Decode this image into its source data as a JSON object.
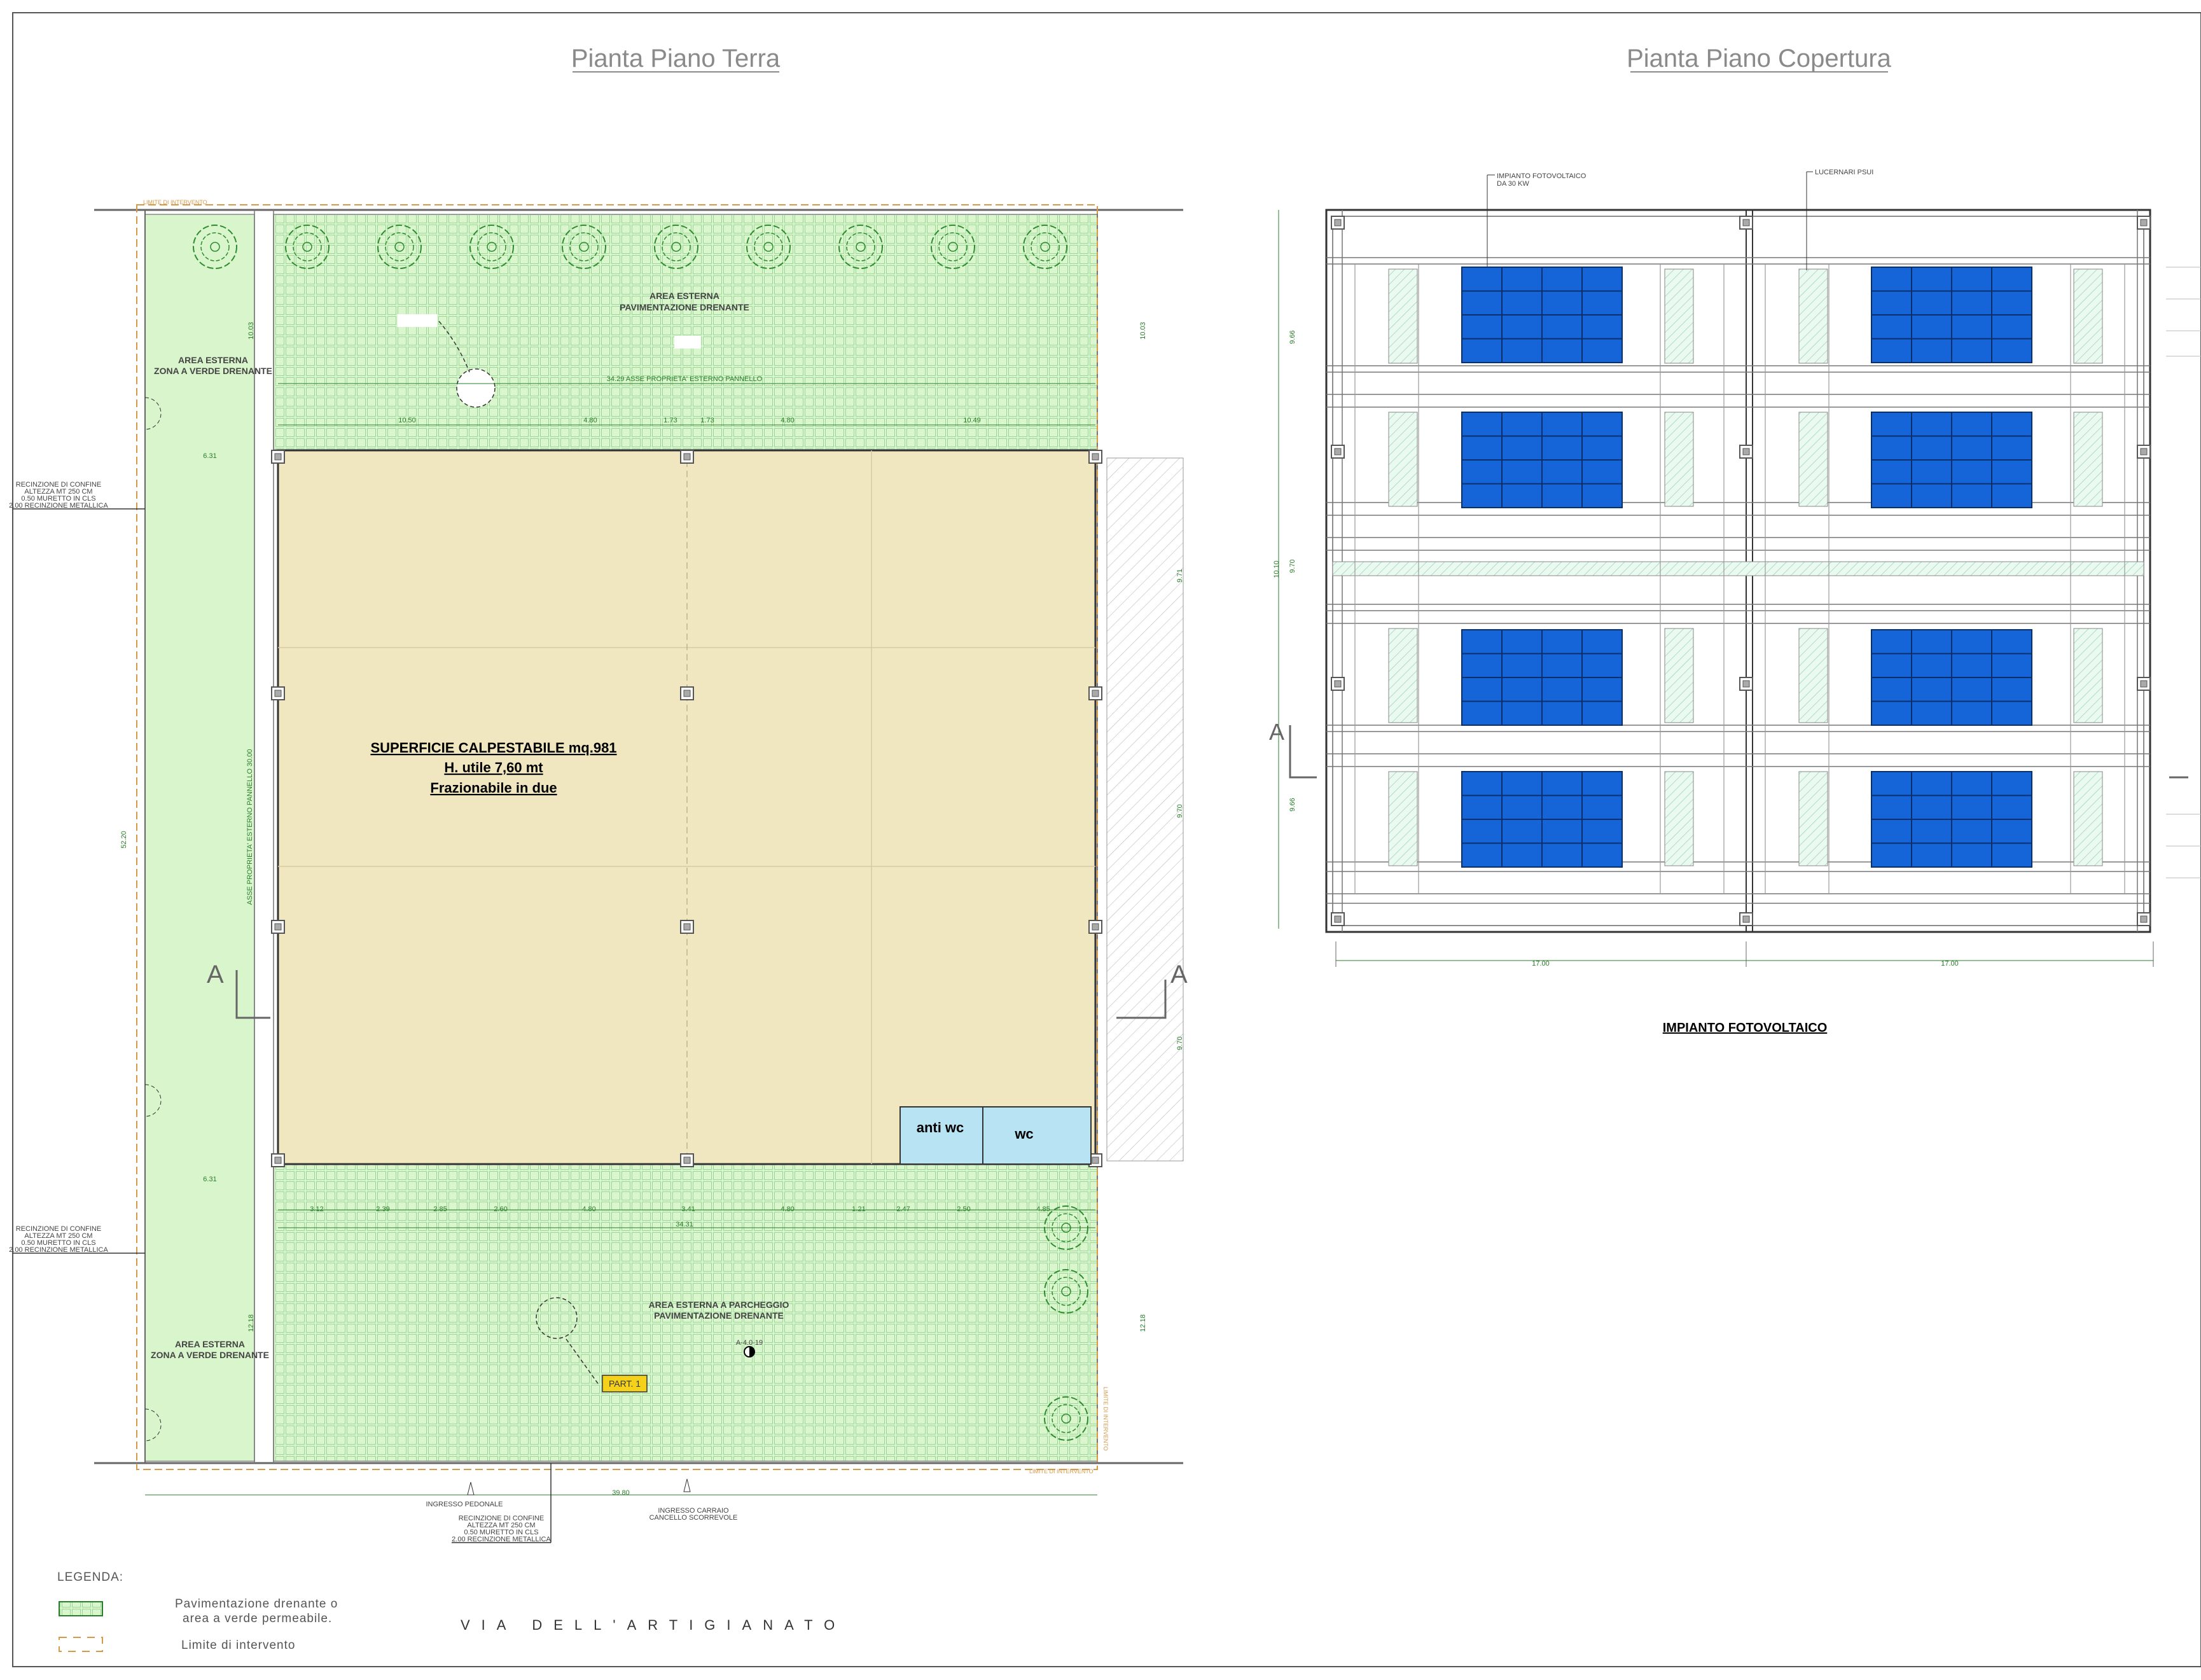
{
  "sheet": {
    "ground_plan_title": "Pianta Piano Terra",
    "roof_plan_title": "Pianta Piano Copertura"
  },
  "ground_plan": {
    "limite_top": "LIMITE DI INTERVENTO",
    "limite_bottom": "LIMITE DI INTERVENTO",
    "limite_right": "LIMITE DI INTERVENTO",
    "area_top": [
      "AREA ESTERNA",
      "PAVIMENTAZIONE DRENANTE"
    ],
    "area_left_top": [
      "AREA ESTERNA",
      "ZONA A VERDE DRENANTE"
    ],
    "area_left_bottom": [
      "AREA ESTERNA",
      "ZONA A VERDE DRENANTE"
    ],
    "area_bottom": [
      "AREA ESTERNA A PARCHEGGIO",
      "PAVIMENTAZIONE DRENANTE"
    ],
    "asse_top": "34.29 ASSE PROPRIETA' ESTERNO PANNELLO",
    "asse_left": "ASSE PROPRIETA' ESTERNO PANNELLO 30.00",
    "main_label": [
      "SUPERFICIE CALPESTABILE mq.981",
      "H. utile 7,60 mt",
      "Frazionabile in due"
    ],
    "anti_wc": "anti wc",
    "wc": "wc",
    "part_tag": "PART. 1",
    "fence_note_1": [
      "RECINZIONE DI CONFINE",
      "ALTEZZA MT 250 CM",
      "0.50 MURETTO IN CLS",
      "2.00 RECINZIONE METALLICA"
    ],
    "fence_note_2": [
      "RECINZIONE DI CONFINE",
      "ALTEZZA MT 250 CM",
      "0.50 MURETTO IN CLS",
      "2.00 RECINZIONE METALLICA"
    ],
    "fence_note_3": [
      "RECINZIONE DI CONFINE",
      "ALTEZZA MT 250 CM",
      "0.50 MURETTO IN CLS",
      "2.00 RECINZIONE METALLICA"
    ],
    "ingresso_pedonale": "INGRESSO PEDONALE",
    "ingresso_carraio": [
      "INGRESSO CARRAIO",
      "CANCELLO SCORREVOLE"
    ],
    "section_mark": "A",
    "dims_top": [
      "10.50",
      "4.80",
      "1.73",
      "1.73",
      "4.80",
      "10.49"
    ],
    "dims_bottom": [
      "3.12",
      "2.39",
      "2.85",
      "2.60",
      "4.80",
      "3.41",
      "4.80",
      "1.21",
      "2.47",
      "2.50",
      "4.85"
    ],
    "dim_total_bottom": "34.31",
    "dim_total_street": "39.80",
    "dim_side_left": "52.20",
    "dim_top_depth": "10.03",
    "dim_bottom_depth": "12.18",
    "dim_right_1": "9.71",
    "dim_right_2": "9.70",
    "dim_right_3": "9.70",
    "dim_left_offset": "6.31",
    "dim_left_offset_2": "6.31",
    "tiny_note": "A-4.0-19"
  },
  "roof_plan": {
    "pv_callout": [
      "IMPIANTO FOTOVOLTAICO",
      "DA 30 KW"
    ],
    "skylight_callout": "LUCERNARI PSUI",
    "dim_bottom": [
      "17.00",
      "17.00"
    ],
    "dim_left": [
      "9.66",
      "10.10",
      "9.70",
      "9.66"
    ],
    "section_mark": "A",
    "caption": "IMPIANTO FOTOVOLTAICO"
  },
  "legend": {
    "title": "LEGENDA:",
    "item1": [
      "Pavimentazione drenante o",
      "area a verde permeabile."
    ],
    "item2": "Limite di intervento"
  },
  "street": "VIA DELL'ARTIGIANATO",
  "colors": {
    "green_fill": "#d8f5cc",
    "green_line": "#8bc98a",
    "building_fill": "#f0e6c0",
    "wc_fill": "#b8e3f2",
    "panel_fill": "#1565d8",
    "tag_fill": "#f4d21c",
    "limit_orange": "#d49a4a"
  }
}
